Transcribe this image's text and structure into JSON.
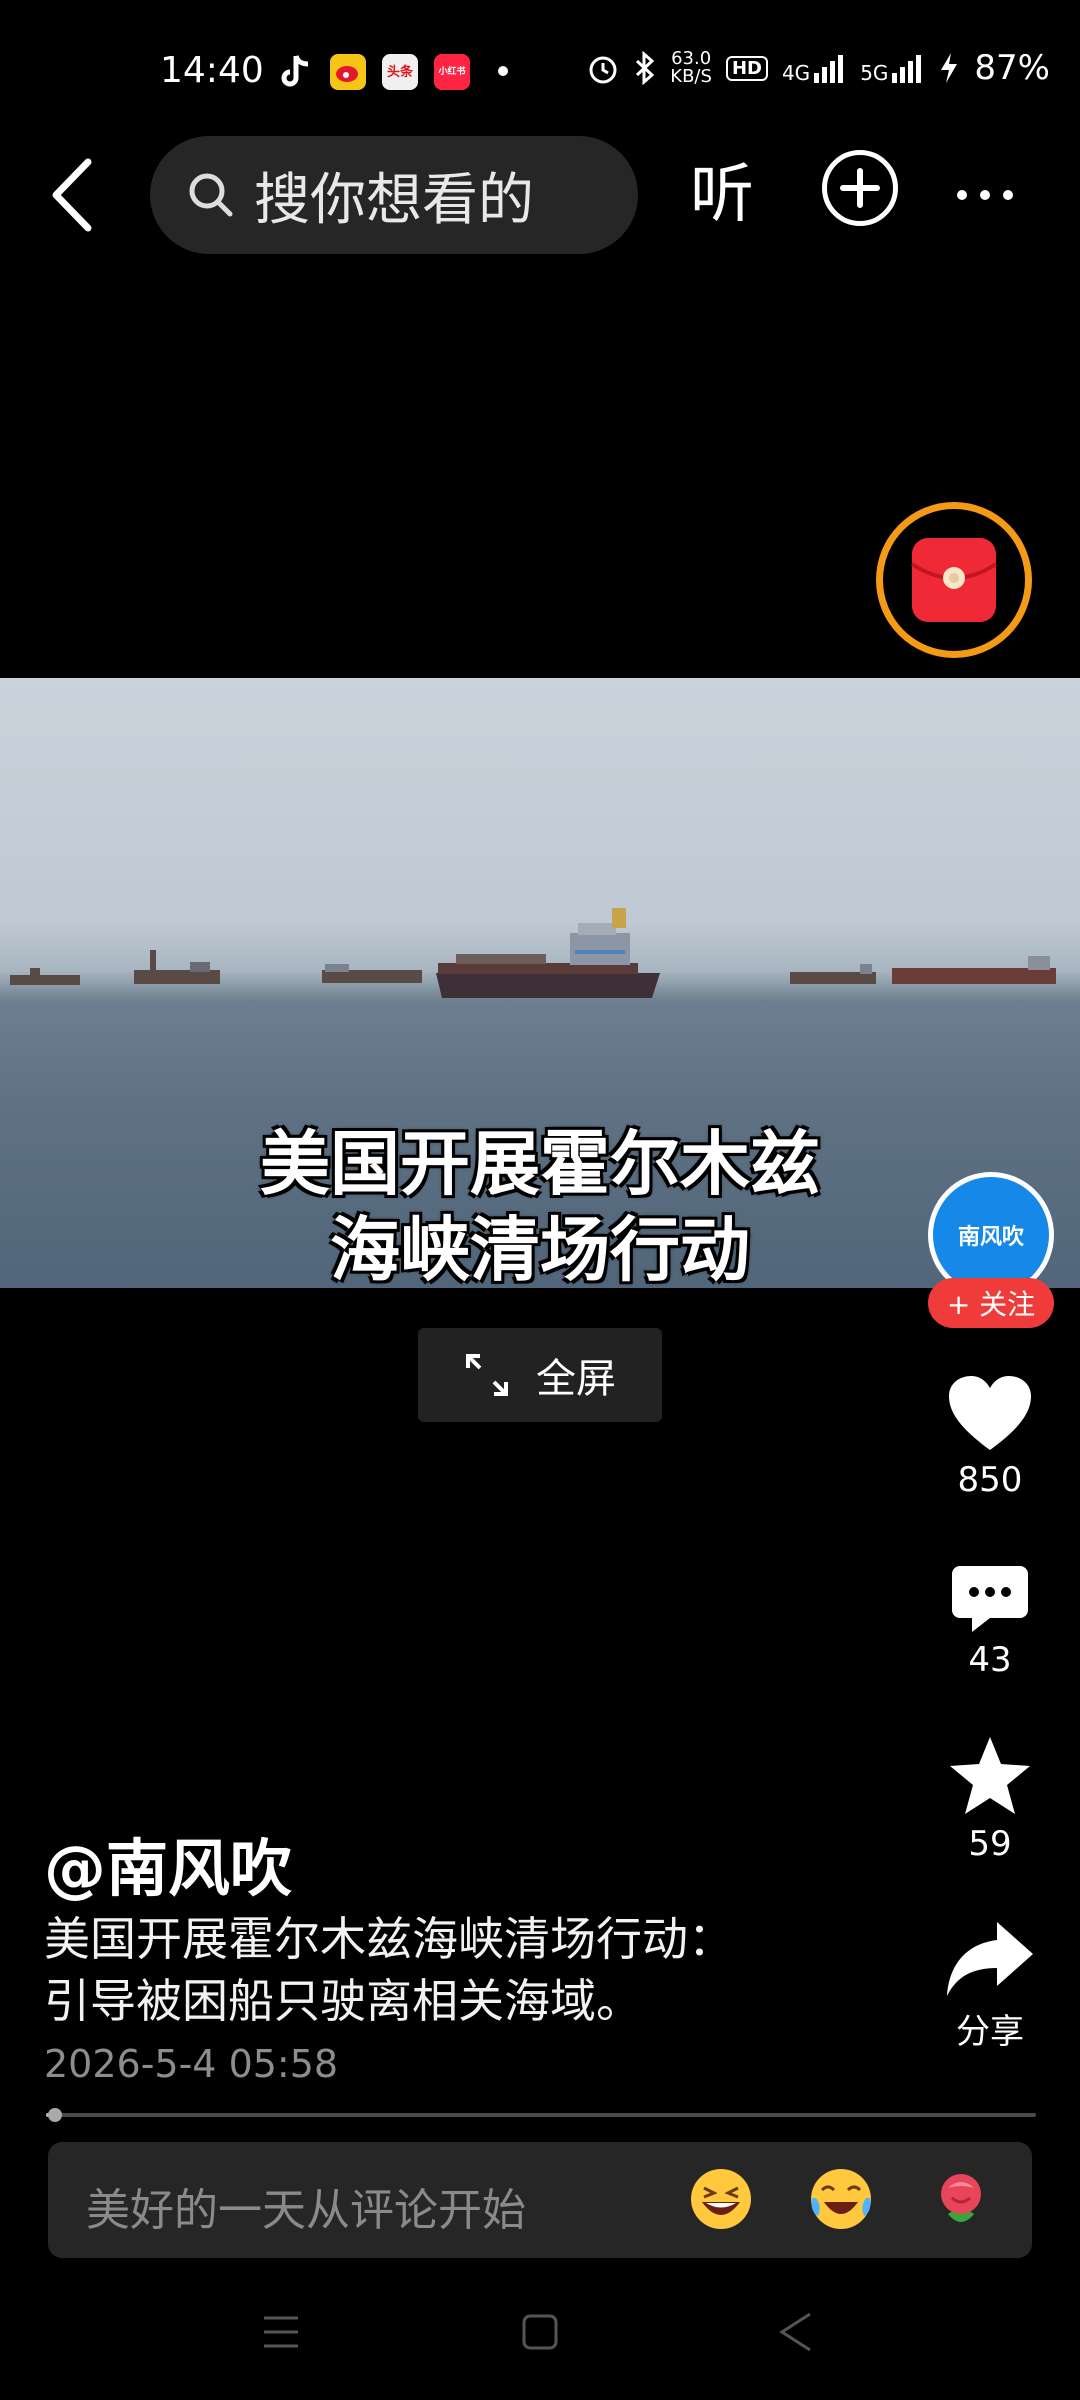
{
  "status_bar": {
    "time": "14:40",
    "net_speed_value": "63.0",
    "net_speed_unit": "KB/S",
    "hd": "HD",
    "net_4g": "4G",
    "net_5g": "5G",
    "battery": "87%",
    "badges": [
      "头条",
      "小红书"
    ]
  },
  "top_nav": {
    "search_placeholder": "搜你想看的",
    "listen": "听"
  },
  "video": {
    "caption_line1": "美国开展霍尔木兹",
    "caption_line2": "海峡清场行动"
  },
  "fullscreen_label": "全屏",
  "rail": {
    "avatar_name": "南风吹",
    "follow": "+ 关注",
    "likes": "850",
    "comments": "43",
    "favorites": "59",
    "share": "分享"
  },
  "post": {
    "author": "@南风吹",
    "desc_line1": "美国开展霍尔木兹海峡清场行动：",
    "desc_line2": "引导被困船只驶离相关海域。",
    "date": "2026-5-4 05:58"
  },
  "progress_fraction": 0.01,
  "comment_box": {
    "placeholder": "美好的一天从评论开始"
  },
  "colors": {
    "accent_orange": "#f59a16",
    "follow_red": "#f03b3b",
    "avatar_blue": "#1688e8"
  }
}
